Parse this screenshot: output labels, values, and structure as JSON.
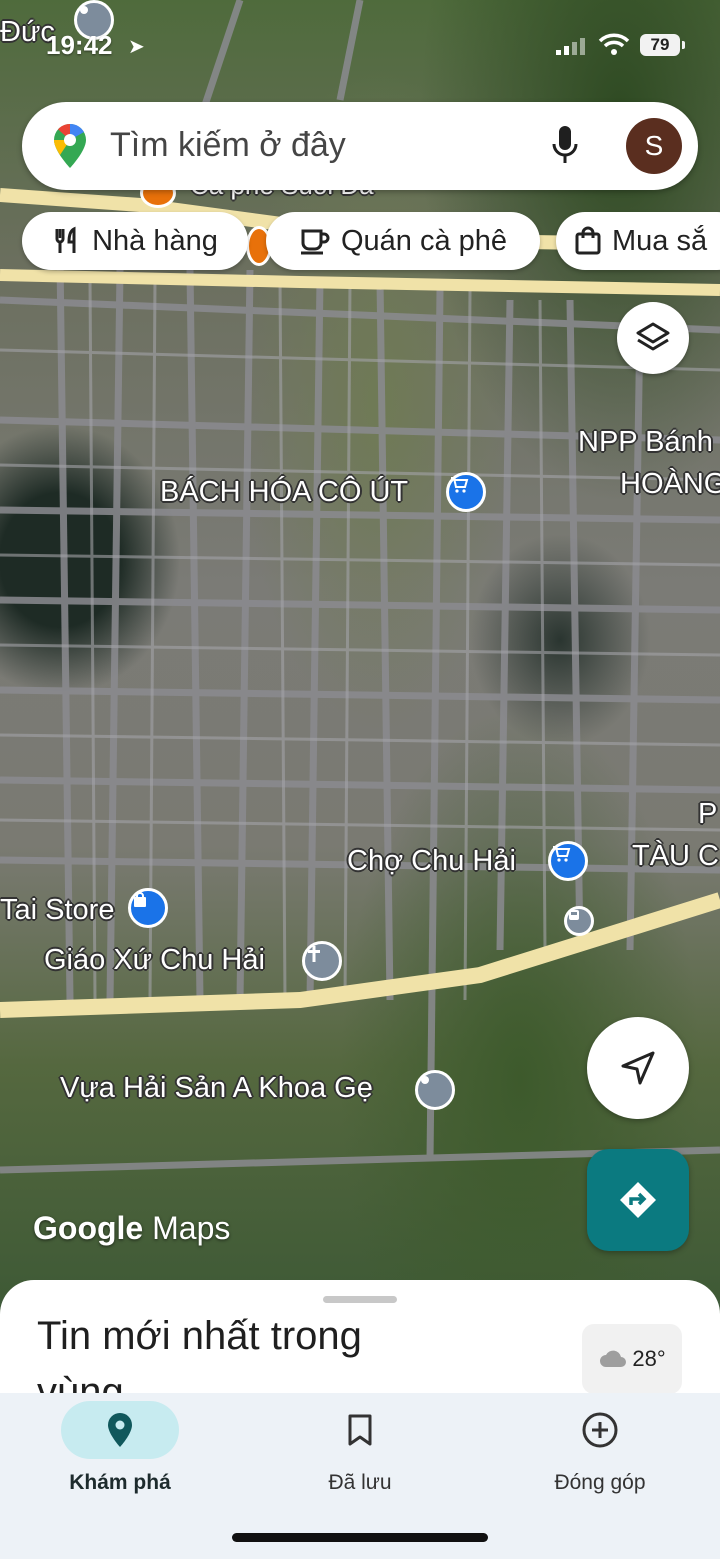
{
  "status_bar": {
    "time": "19:42",
    "battery": "79"
  },
  "search": {
    "placeholder": "Tìm kiếm ở đây",
    "avatar_letter": "S"
  },
  "chips": [
    {
      "label": "Nhà hàng",
      "icon": "fork-knife-icon"
    },
    {
      "label": "Quán cà phê",
      "icon": "coffee-cup-icon"
    },
    {
      "label": "Mua sắ",
      "icon": "shopping-bag-icon"
    }
  ],
  "map_labels": {
    "top_left_place": "Đức",
    "top_cut": "Cà phê Suối Đá",
    "bach_hoa": "BÁCH HÓA CÔ ÚT",
    "npp_line1": "NPP Bánh",
    "npp_line2": "HOÀNG",
    "cho": "Chợ Chu Hải",
    "pt_line1": "P",
    "pt_line2": "TÀU C",
    "tai_store": "Tai Store",
    "giao_xu": "Giáo Xứ Chu Hải",
    "vua_hai_san": "Vựa Hải Sản A Khoa Gẹ"
  },
  "watermark": {
    "brand": "Google",
    "product": "Maps"
  },
  "sheet": {
    "title": "Tin mới nhất trong vùng",
    "temperature": "28°"
  },
  "nav": {
    "explore": "Khám phá",
    "saved": "Đã lưu",
    "contribute": "Đóng góp"
  },
  "colors": {
    "accent": "#0b7a80",
    "poi_blue": "#1a73e8",
    "road_main": "#f0e2a8"
  }
}
